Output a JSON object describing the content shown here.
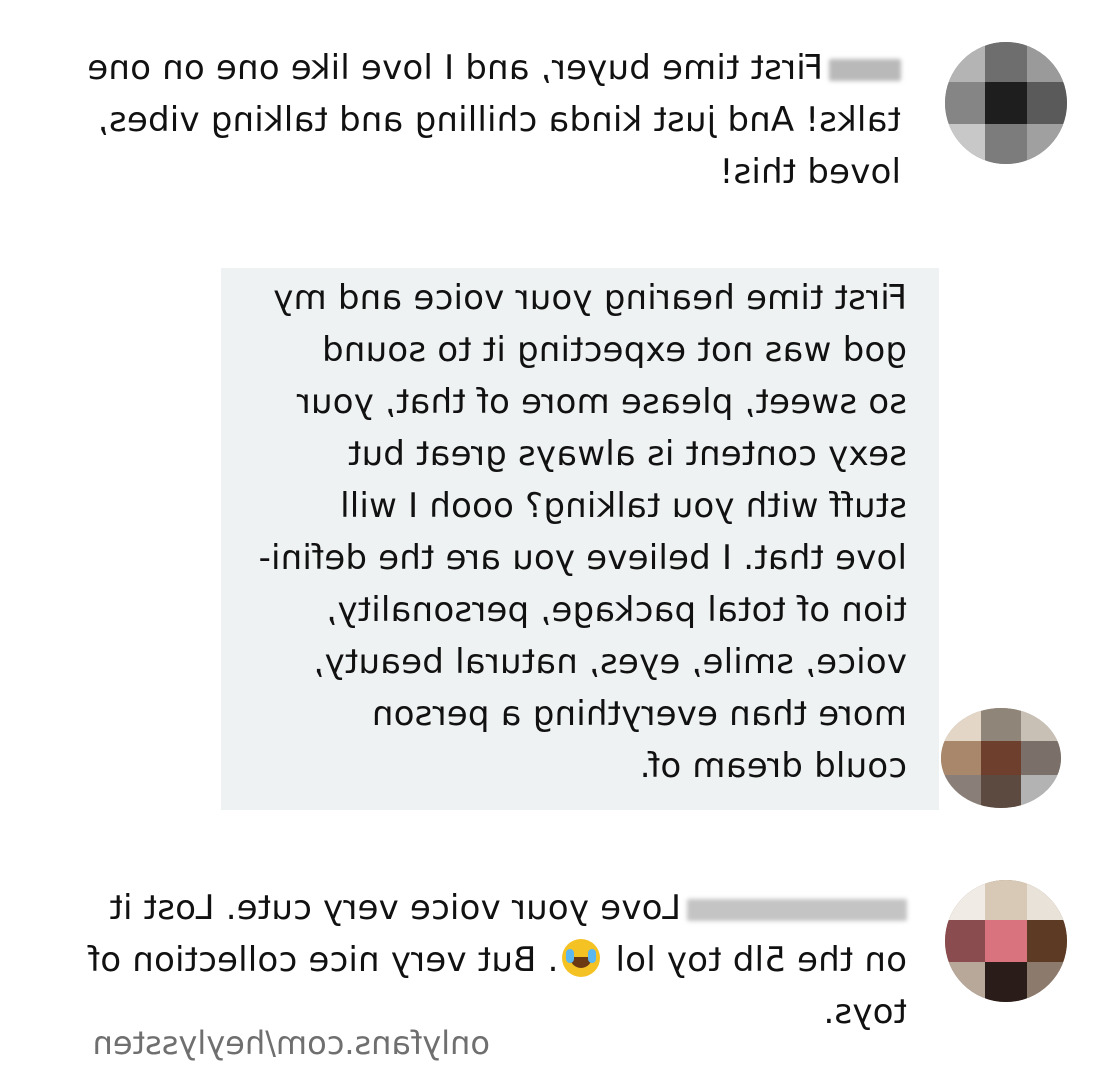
{
  "comments": [
    {
      "lines": [
        "First time buyer, and I love like one on one",
        "talks! And just kinda chilling and talking vibes,",
        "loved this!"
      ]
    },
    {
      "lines": [
        "First time hearing your voice and my",
        "god was not expecting it to sound",
        "so sweet, please more of that, your",
        "sexy content is always great but",
        "stuff with you talking? oooh I will",
        "love that. I believe you are the defini-",
        "tion of total package, personality,",
        "voice, smile, eyes, natural beauty,",
        "more than everything a person",
        "could dream of."
      ]
    },
    {
      "line1": "Love your voice very cute. Lost it",
      "line2_before": "on the 5lb toy lol",
      "line2_after": ". But very nice collection of",
      "line3": "toys.",
      "emoji": "face-with-tears-of-joy-icon"
    }
  ],
  "watermark": "onlyfans.com/heylyssten",
  "colors": {
    "reply_background": "#eff2f3",
    "watermark": "#6f6f6f"
  }
}
